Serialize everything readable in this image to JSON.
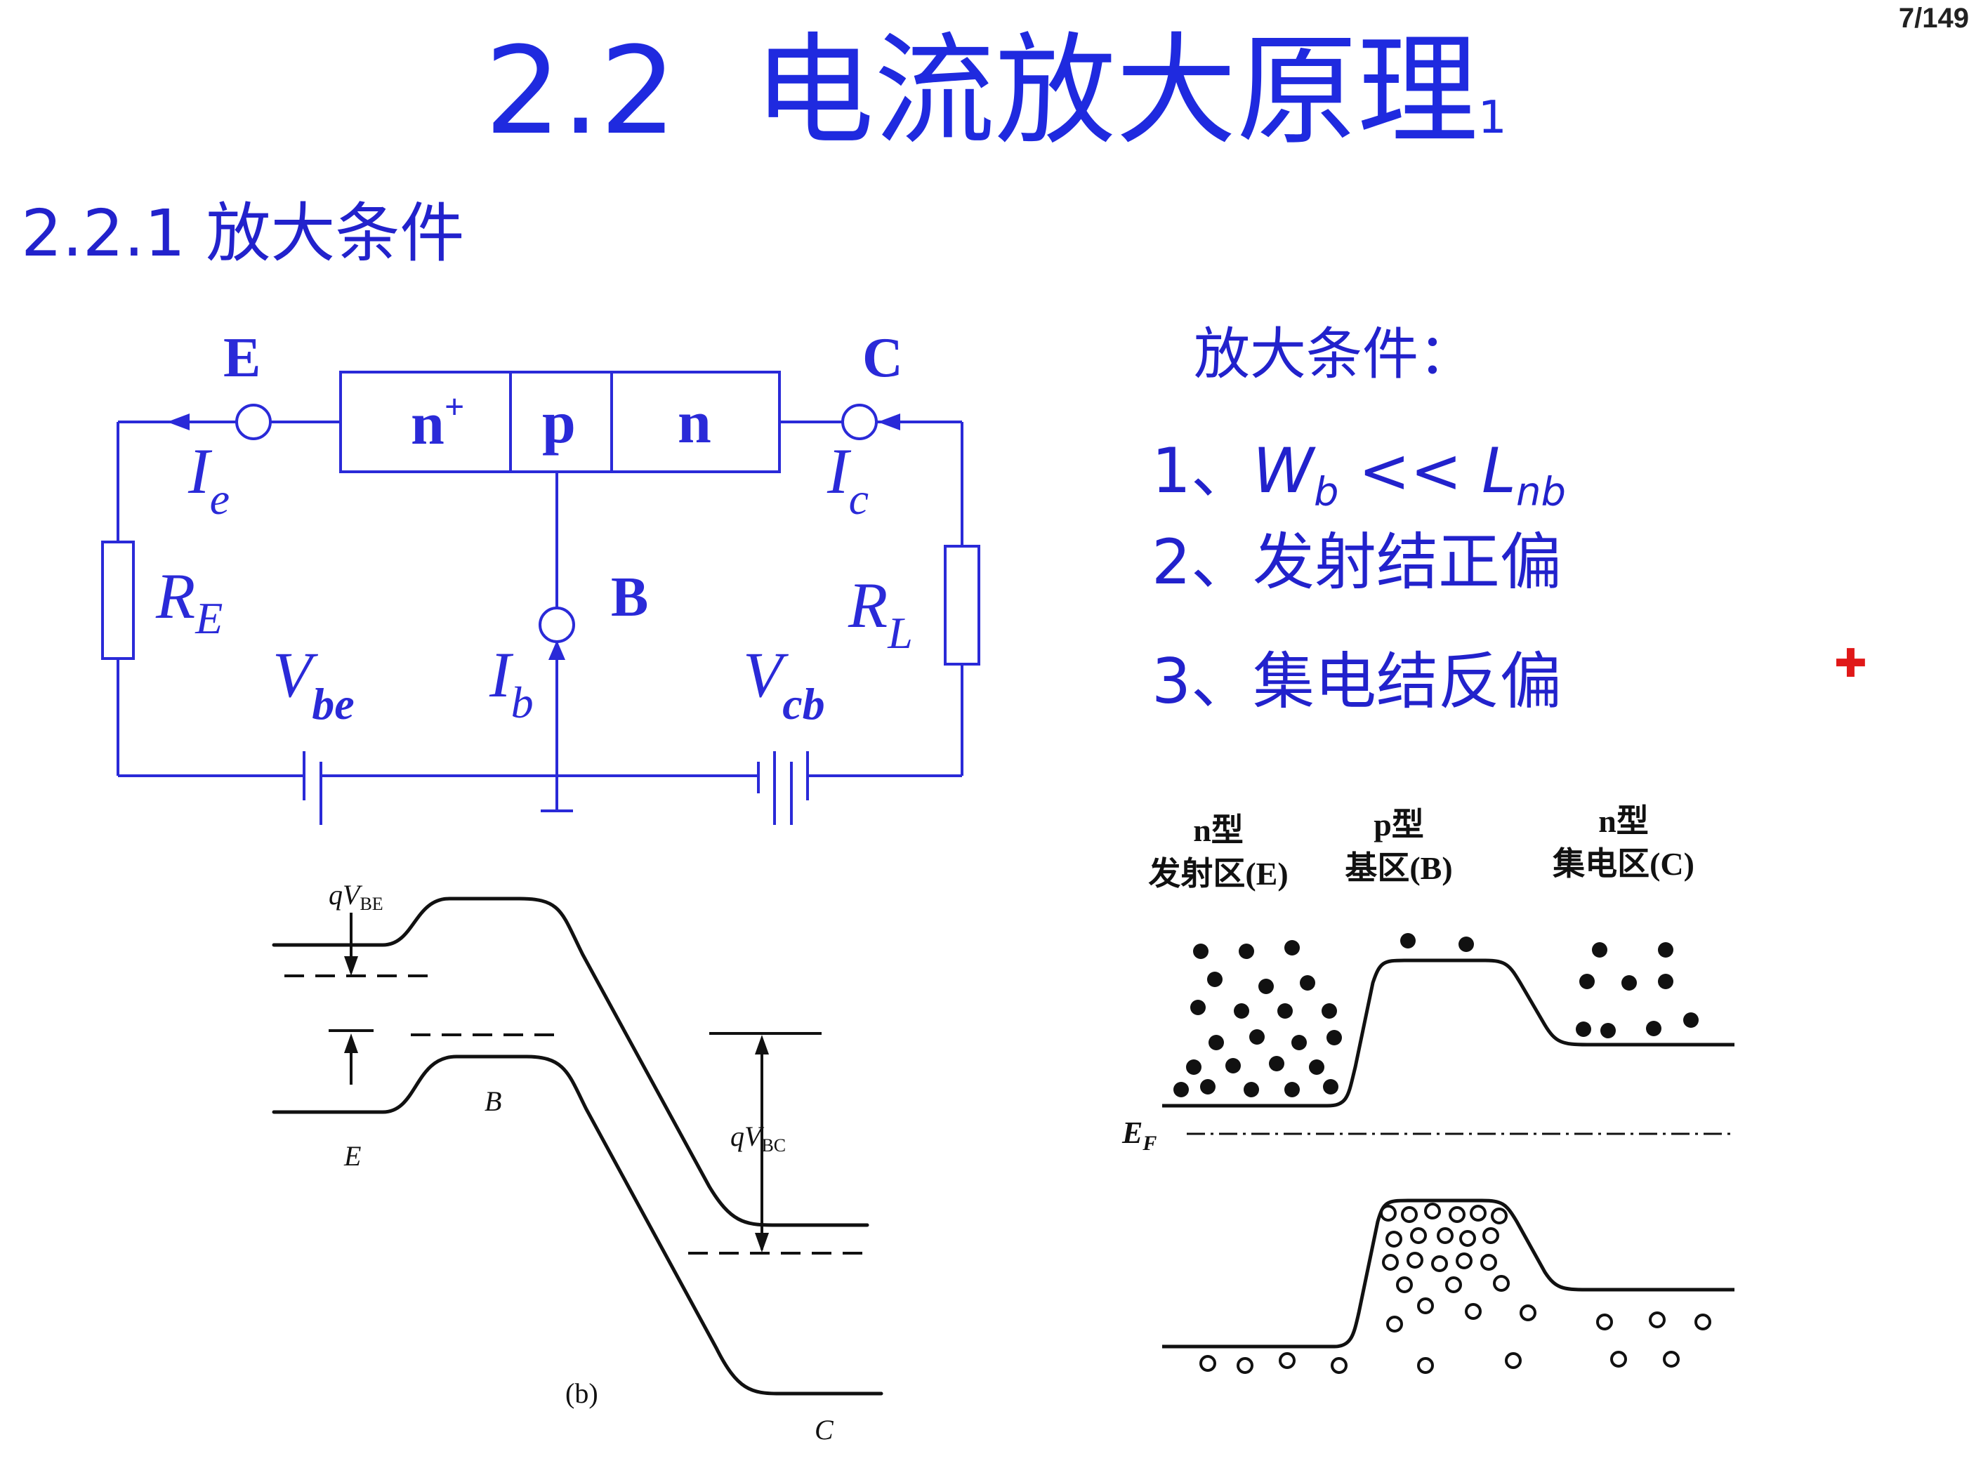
{
  "page": {
    "counter": "7/149",
    "title_main": "2.2  电流放大原理",
    "title_sub": "1",
    "section": "2.2.1 放大条件"
  },
  "circuit": {
    "emitter_label": "E",
    "collector_label": "C",
    "base_label": "B",
    "region_n_plus": "n",
    "region_n_plus_sup": "+",
    "region_p": "p",
    "region_n": "n",
    "ie": "I",
    "ie_sub": "e",
    "ic": "I",
    "ic_sub": "c",
    "ib": "I",
    "ib_sub": "b",
    "re": "R",
    "re_sub": "E",
    "rl": "R",
    "rl_sub": "L",
    "vbe": "V",
    "vbe_sub": "be",
    "vcb": "V",
    "vcb_sub": "cb"
  },
  "conditions": {
    "title": "放大条件：",
    "item1_prefix": "1、",
    "item1_w": "W",
    "item1_w_sub": "b",
    "item1_op": " << ",
    "item1_l": "L",
    "item1_l_sub": "nb",
    "item2": "2、发射结正偏",
    "item3": "3、集电结反偏"
  },
  "band_diagram_left": {
    "qvbe": "qV",
    "qvbe_sub": "BE",
    "qvbc": "qV",
    "qvbc_sub": "BC",
    "label_e": "E",
    "label_b": "B",
    "label_c": "C",
    "caption": "(b)"
  },
  "band_diagram_right": {
    "emitter_type": "n型",
    "emitter_name": "发射区(E)",
    "base_type": "p型",
    "base_name": "基区(B)",
    "collector_type": "n型",
    "collector_name": "集电区(C)",
    "fermi_label": "E",
    "fermi_sub": "F"
  },
  "marker": {
    "symbol": "✚",
    "color": "#e01818"
  }
}
